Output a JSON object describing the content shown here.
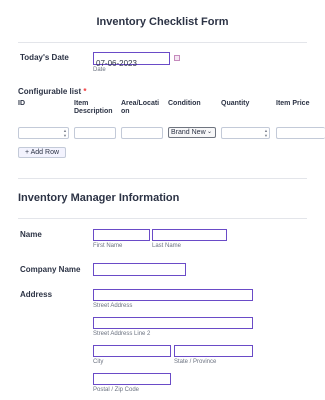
{
  "form": {
    "title": "Inventory Checklist Form"
  },
  "date_field": {
    "label": "Today's Date",
    "value": "07-06-2023",
    "sublabel": "Date"
  },
  "config_list": {
    "label": "Configurable list",
    "required_mark": "*",
    "columns": [
      "ID",
      "Item Description",
      "Area/Location",
      "Condition",
      "Quantity",
      "Item Price"
    ],
    "condition_selected": "Brand New",
    "add_row_label": "+ Add Row"
  },
  "manager_section": {
    "title": "Inventory Manager Information"
  },
  "name_field": {
    "label": "Name",
    "first_sublabel": "First Name",
    "last_sublabel": "Last Name"
  },
  "company_field": {
    "label": "Company Name"
  },
  "address_field": {
    "label": "Address",
    "street_sublabel": "Street Address",
    "street2_sublabel": "Street Address Line 2",
    "city_sublabel": "City",
    "state_sublabel": "State / Province",
    "postal_sublabel": "Postal / Zip Code"
  },
  "colors": {
    "accent": "#6a4bc7",
    "required": "#f23a3c",
    "text": "#2c3345"
  }
}
